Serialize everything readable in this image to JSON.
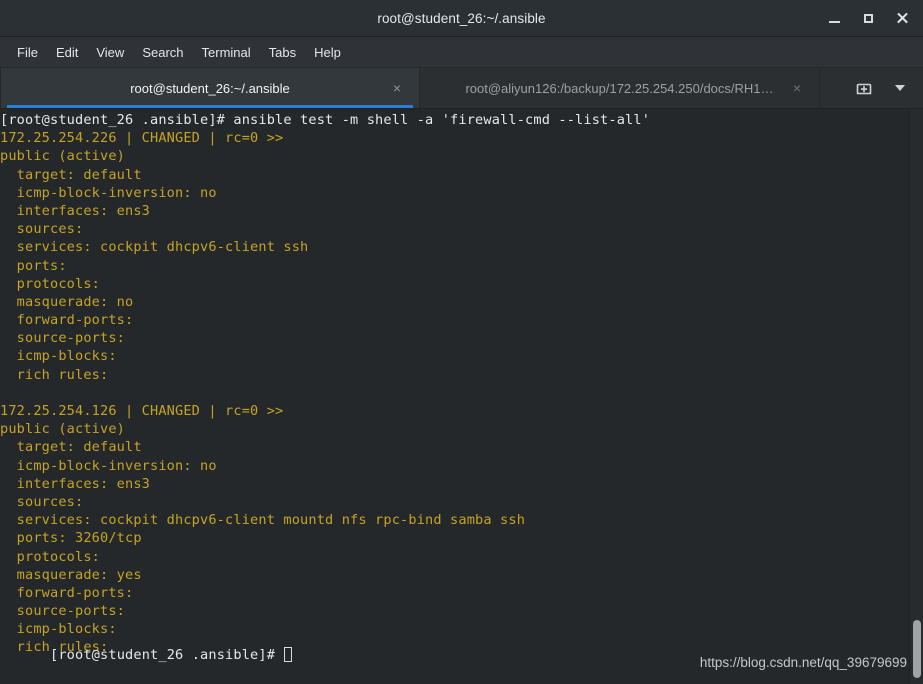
{
  "window": {
    "title": "root@student_26:~/.ansible",
    "controls": {
      "minimize_label": "Minimize",
      "maximize_label": "Maximize",
      "close_label": "Close"
    }
  },
  "menubar": {
    "items": [
      {
        "label": "File"
      },
      {
        "label": "Edit"
      },
      {
        "label": "View"
      },
      {
        "label": "Search"
      },
      {
        "label": "Terminal"
      },
      {
        "label": "Tabs"
      },
      {
        "label": "Help"
      }
    ]
  },
  "tabbar": {
    "tabs": [
      {
        "label": "root@student_26:~/.ansible",
        "active": true,
        "close": "×"
      },
      {
        "label": "root@aliyun126:/backup/172.25.254.250/docs/RH1…",
        "active": false,
        "close": "×"
      }
    ],
    "new_tab_icon": "new-tab-icon",
    "tab_list_icon": "chevron-down-icon"
  },
  "terminal": {
    "colors": {
      "background": "#24282a",
      "output_text": "#c5a324",
      "command_text": "#e6e8ea",
      "cursor": "#d9dbdd"
    },
    "lines": [
      {
        "text": "[root@student_26 .ansible]# ansible test -m shell -a 'firewall-cmd --list-all'",
        "kind": "command"
      },
      {
        "text": "172.25.254.226 | CHANGED | rc=0 >>",
        "kind": "output"
      },
      {
        "text": "public (active)",
        "kind": "output"
      },
      {
        "text": "  target: default",
        "kind": "output"
      },
      {
        "text": "  icmp-block-inversion: no",
        "kind": "output"
      },
      {
        "text": "  interfaces: ens3",
        "kind": "output"
      },
      {
        "text": "  sources:",
        "kind": "output"
      },
      {
        "text": "  services: cockpit dhcpv6-client ssh",
        "kind": "output"
      },
      {
        "text": "  ports:",
        "kind": "output"
      },
      {
        "text": "  protocols:",
        "kind": "output"
      },
      {
        "text": "  masquerade: no",
        "kind": "output"
      },
      {
        "text": "  forward-ports:",
        "kind": "output"
      },
      {
        "text": "  source-ports:",
        "kind": "output"
      },
      {
        "text": "  icmp-blocks:",
        "kind": "output"
      },
      {
        "text": "  rich rules:",
        "kind": "output"
      },
      {
        "text": "",
        "kind": "output"
      },
      {
        "text": "172.25.254.126 | CHANGED | rc=0 >>",
        "kind": "output"
      },
      {
        "text": "public (active)",
        "kind": "output"
      },
      {
        "text": "  target: default",
        "kind": "output"
      },
      {
        "text": "  icmp-block-inversion: no",
        "kind": "output"
      },
      {
        "text": "  interfaces: ens3",
        "kind": "output"
      },
      {
        "text": "  sources:",
        "kind": "output"
      },
      {
        "text": "  services: cockpit dhcpv6-client mountd nfs rpc-bind samba ssh",
        "kind": "output"
      },
      {
        "text": "  ports: 3260/tcp",
        "kind": "output"
      },
      {
        "text": "  protocols:",
        "kind": "output"
      },
      {
        "text": "  masquerade: yes",
        "kind": "output"
      },
      {
        "text": "  forward-ports:",
        "kind": "output"
      },
      {
        "text": "  source-ports:",
        "kind": "output"
      },
      {
        "text": "  icmp-blocks:",
        "kind": "output"
      },
      {
        "text": "  rich rules:",
        "kind": "output"
      },
      {
        "text": "",
        "kind": "output"
      }
    ],
    "prompt": "[root@student_26 .ansible]# "
  },
  "watermark": {
    "text": "https://blog.csdn.net/qq_39679699"
  }
}
